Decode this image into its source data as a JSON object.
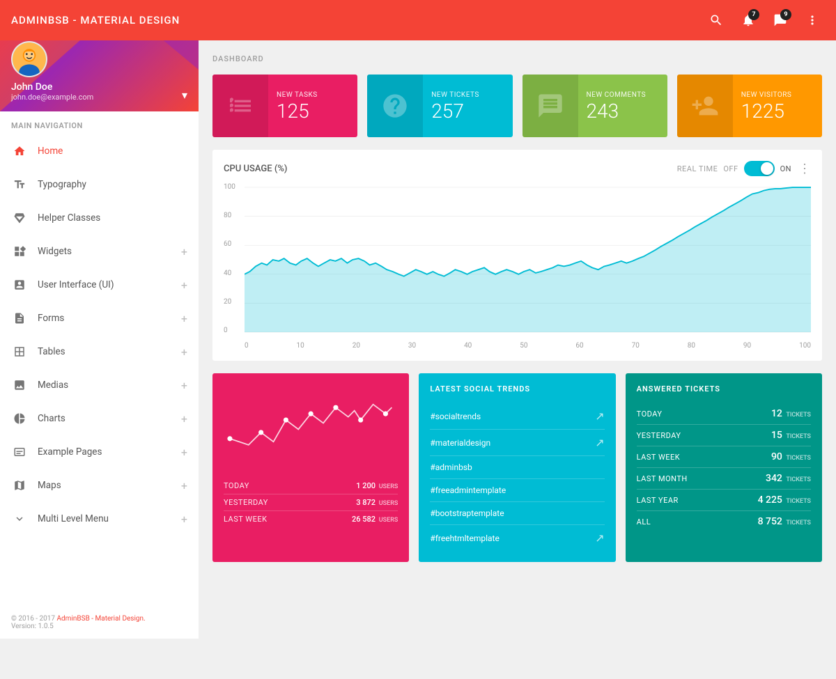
{
  "app": {
    "title": "ADMINBSB - MATERIAL DESIGN"
  },
  "topnav": {
    "notifications_count": "7",
    "messages_count": "9"
  },
  "sidebar": {
    "profile": {
      "name": "John Doe",
      "email": "john.doe@example.com"
    },
    "nav_label": "MAIN NAVIGATION",
    "items": [
      {
        "id": "home",
        "label": "Home",
        "icon": "home",
        "active": true,
        "has_plus": false
      },
      {
        "id": "typography",
        "label": "Typography",
        "icon": "typography",
        "active": false,
        "has_plus": false
      },
      {
        "id": "helper-classes",
        "label": "Helper Classes",
        "icon": "diamond",
        "active": false,
        "has_plus": false
      },
      {
        "id": "widgets",
        "label": "Widgets",
        "icon": "widgets",
        "active": false,
        "has_plus": true
      },
      {
        "id": "ui",
        "label": "User Interface (UI)",
        "icon": "ui",
        "active": false,
        "has_plus": true
      },
      {
        "id": "forms",
        "label": "Forms",
        "icon": "forms",
        "active": false,
        "has_plus": true
      },
      {
        "id": "tables",
        "label": "Tables",
        "icon": "tables",
        "active": false,
        "has_plus": true
      },
      {
        "id": "medias",
        "label": "Medias",
        "icon": "medias",
        "active": false,
        "has_plus": true
      },
      {
        "id": "charts",
        "label": "Charts",
        "icon": "charts",
        "active": false,
        "has_plus": true
      },
      {
        "id": "example-pages",
        "label": "Example Pages",
        "icon": "pages",
        "active": false,
        "has_plus": true
      },
      {
        "id": "maps",
        "label": "Maps",
        "icon": "maps",
        "active": false,
        "has_plus": true
      },
      {
        "id": "multi-level",
        "label": "Multi Level Menu",
        "icon": "menu",
        "active": false,
        "has_plus": true
      }
    ],
    "footer": {
      "copyright": "© 2016 - 2017 ",
      "link_text": "AdminBSB - Material Design.",
      "version": "Version: 1.0.5"
    }
  },
  "dashboard": {
    "page_title": "DASHBOARD",
    "stat_cards": [
      {
        "label": "NEW TASKS",
        "value": "125",
        "color": "pink"
      },
      {
        "label": "NEW TICKETS",
        "value": "257",
        "color": "cyan"
      },
      {
        "label": "NEW COMMENTS",
        "value": "243",
        "color": "green"
      },
      {
        "label": "NEW VISITORS",
        "value": "1225",
        "color": "orange"
      }
    ],
    "cpu_chart": {
      "title": "CPU USAGE (%)",
      "realtime_label": "REAL TIME",
      "off_label": "OFF",
      "on_label": "ON",
      "y_labels": [
        "0",
        "20",
        "40",
        "60",
        "80",
        "100"
      ],
      "x_labels": [
        "0",
        "10",
        "20",
        "30",
        "40",
        "50",
        "60",
        "70",
        "80",
        "90",
        "100"
      ]
    },
    "visitors_chart": {
      "stats": [
        {
          "label": "TODAY",
          "value": "1 200",
          "unit": "USERS"
        },
        {
          "label": "YESTERDAY",
          "value": "3 872",
          "unit": "USERS"
        },
        {
          "label": "LAST WEEK",
          "value": "26 582",
          "unit": "USERS"
        }
      ]
    },
    "social_trends": {
      "title": "LATEST SOCIAL TRENDS",
      "items": [
        {
          "tag": "#socialtrends",
          "trending": true
        },
        {
          "tag": "#materialdesign",
          "trending": true
        },
        {
          "tag": "#adminbsb",
          "trending": false
        },
        {
          "tag": "#freeadmintemplate",
          "trending": false
        },
        {
          "tag": "#bootstraptemplate",
          "trending": false
        },
        {
          "tag": "#freehtmltemplate",
          "trending": true
        }
      ]
    },
    "answered_tickets": {
      "title": "ANSWERED TICKETS",
      "rows": [
        {
          "label": "TODAY",
          "count": "12",
          "unit": "TICKETS"
        },
        {
          "label": "YESTERDAY",
          "count": "15",
          "unit": "TICKETS"
        },
        {
          "label": "LAST WEEK",
          "count": "90",
          "unit": "TICKETS"
        },
        {
          "label": "LAST MONTH",
          "count": "342",
          "unit": "TICKETS"
        },
        {
          "label": "LAST YEAR",
          "count": "4 225",
          "unit": "TICKETS"
        },
        {
          "label": "ALL",
          "count": "8 752",
          "unit": "TICKETS"
        }
      ]
    }
  },
  "colors": {
    "red": "#f44336",
    "pink": "#e91e63",
    "cyan": "#00bcd4",
    "green": "#8bc34a",
    "orange": "#ff9800",
    "teal": "#009688"
  }
}
